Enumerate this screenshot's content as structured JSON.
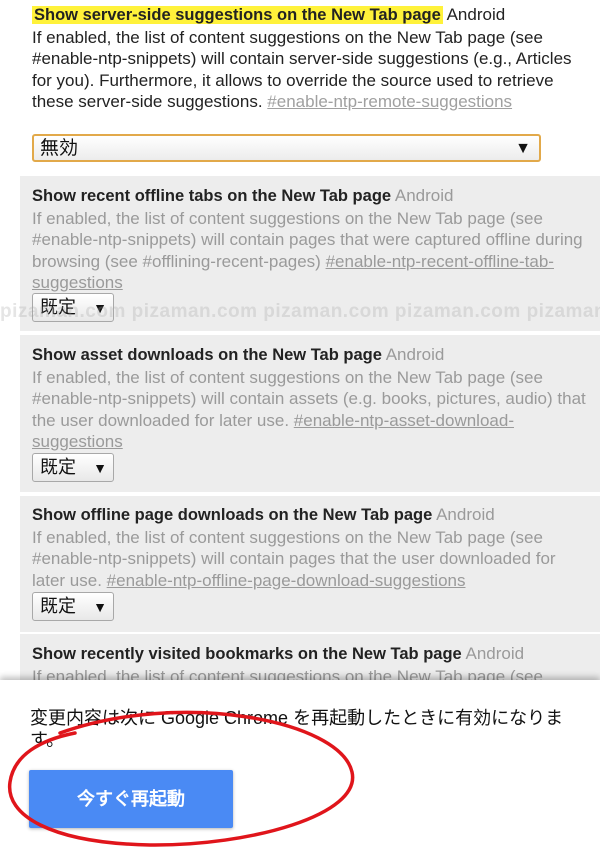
{
  "flags": [
    {
      "title": "Show server-side suggestions on the New Tab page",
      "platform": "Android",
      "description": "If enabled, the list of content suggestions on the New Tab page (see #enable-ntp-snippets) will contain server-side suggestions (e.g., Articles for you). Furthermore, it allows to override the source used to retrieve these server-side suggestions. ",
      "link": "#enable-ntp-remote-suggestions",
      "select_value": "無効",
      "state": "enabled"
    },
    {
      "title": "Show recent offline tabs on the New Tab page",
      "platform": "Android",
      "description": "If enabled, the list of content suggestions on the New Tab page (see #enable-ntp-snippets) will contain pages that were captured offline during browsing (see #offlining-recent-pages) ",
      "link": "#enable-ntp-recent-offline-tab-suggestions",
      "select_value": "既定",
      "state": "default"
    },
    {
      "title": "Show asset downloads on the New Tab page",
      "platform": "Android",
      "description": "If enabled, the list of content suggestions on the New Tab page (see #enable-ntp-snippets) will contain assets (e.g. books, pictures, audio) that the user downloaded for later use. ",
      "link": "#enable-ntp-asset-download-suggestions",
      "select_value": "既定",
      "state": "default"
    },
    {
      "title": "Show offline page downloads on the New Tab page",
      "platform": "Android",
      "description": "If enabled, the list of content suggestions on the New Tab page (see #enable-ntp-snippets) will contain pages that the user downloaded for later use. ",
      "link": "#enable-ntp-offline-page-download-suggestions",
      "select_value": "既定",
      "state": "default"
    },
    {
      "title": "Show recently visited bookmarks on the New Tab page",
      "platform": "Android",
      "description": "If enabled, the list of content suggestions on the New Tab page (see",
      "link": "",
      "state": "default"
    }
  ],
  "select_arrow": "▼",
  "watermark": "pizaman.com pizaman.com pizaman.com pizaman.com pizaman.com pizaman.com",
  "restart_panel": {
    "message": "変更内容は次に Google Chrome を再起動したときに有効になります。",
    "button_label": "今すぐ再起動"
  },
  "colors": {
    "highlight": "#fff23a",
    "button": "#4a8af4",
    "annotation": "#e0151b",
    "select_border": "#e2a94a"
  }
}
